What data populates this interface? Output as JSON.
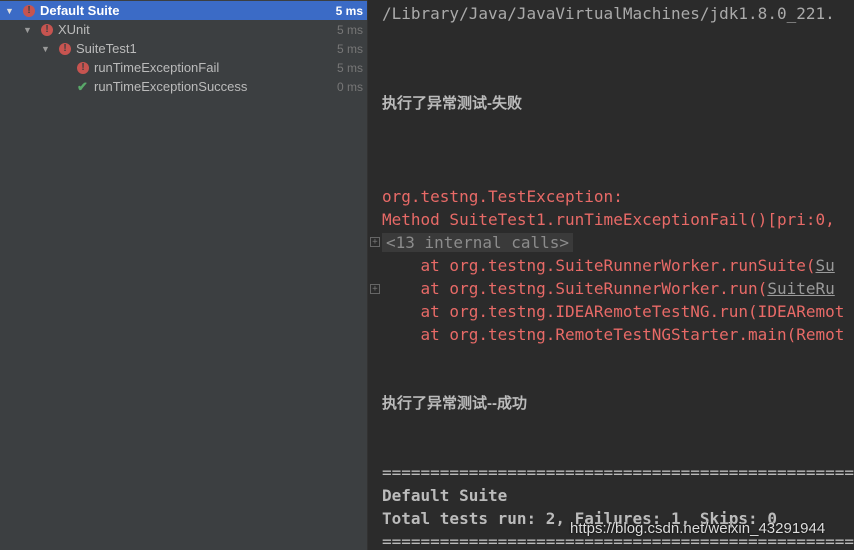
{
  "tree": [
    {
      "label": "Default Suite",
      "time": "5 ms",
      "status": "fail",
      "selected": true
    },
    {
      "label": "XUnit",
      "time": "5 ms",
      "status": "fail"
    },
    {
      "label": "SuiteTest1",
      "time": "5 ms",
      "status": "fail"
    },
    {
      "label": "runTimeExceptionFail",
      "time": "5 ms",
      "status": "fail"
    },
    {
      "label": "runTimeExceptionSuccess",
      "time": "0 ms",
      "status": "pass"
    }
  ],
  "console": {
    "path": "/Library/Java/JavaVirtualMachines/jdk1.8.0_221.",
    "msg_fail": "执行了异常测试-失败",
    "exc1": "org.testng.TestException:",
    "exc2": "Method SuiteTest1.runTimeExceptionFail()[pri:0,",
    "internal": "<13 internal calls>",
    "st1_pre": "    at org.testng.SuiteRunnerWorker.runSuite(",
    "st1_link": "Su",
    "st2_pre": "    at org.testng.SuiteRunnerWorker.run(",
    "st2_link": "SuiteRu",
    "st3": "    at org.testng.IDEARemoteTestNG.run(IDEARemot",
    "st4": "    at org.testng.RemoteTestNGStarter.main(Remot",
    "msg_success": "执行了异常测试--成功",
    "sep": "===================================================",
    "suite": "Default Suite",
    "summary": "Total tests run: 2, Failures: 1, Skips: 0"
  },
  "watermark": "https://blog.csdn.net/weixin_43291944",
  "colors": {
    "error": "#e86a67",
    "selection": "#3b6bc6",
    "pass": "#59a869"
  }
}
